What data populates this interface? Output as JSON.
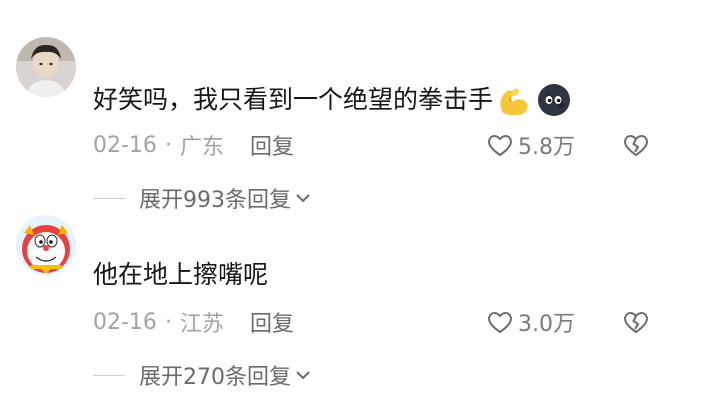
{
  "comments": [
    {
      "avatar": "avatar-young-man-photo",
      "text": "好笑吗，我只看到一个绝望的拳击手",
      "emojis": [
        "flexed-biceps-emoji",
        "dark-moon-face-emoji"
      ],
      "date": "02-16",
      "separator": "·",
      "location": "广东",
      "reply_label": "回复",
      "likes": "5.8万",
      "expand_label": "展开993条回复"
    },
    {
      "avatar": "avatar-doraemon-cartoon",
      "text": "他在地上擦嘴呢",
      "emojis": [],
      "date": "02-16",
      "separator": "·",
      "location": "江苏",
      "reply_label": "回复",
      "likes": "3.0万",
      "expand_label": "展开270条回复"
    }
  ],
  "colors": {
    "text_primary": "#161616",
    "text_meta": "#a3a3a3",
    "text_action": "#6b6b6b",
    "background": "#ffffff"
  }
}
